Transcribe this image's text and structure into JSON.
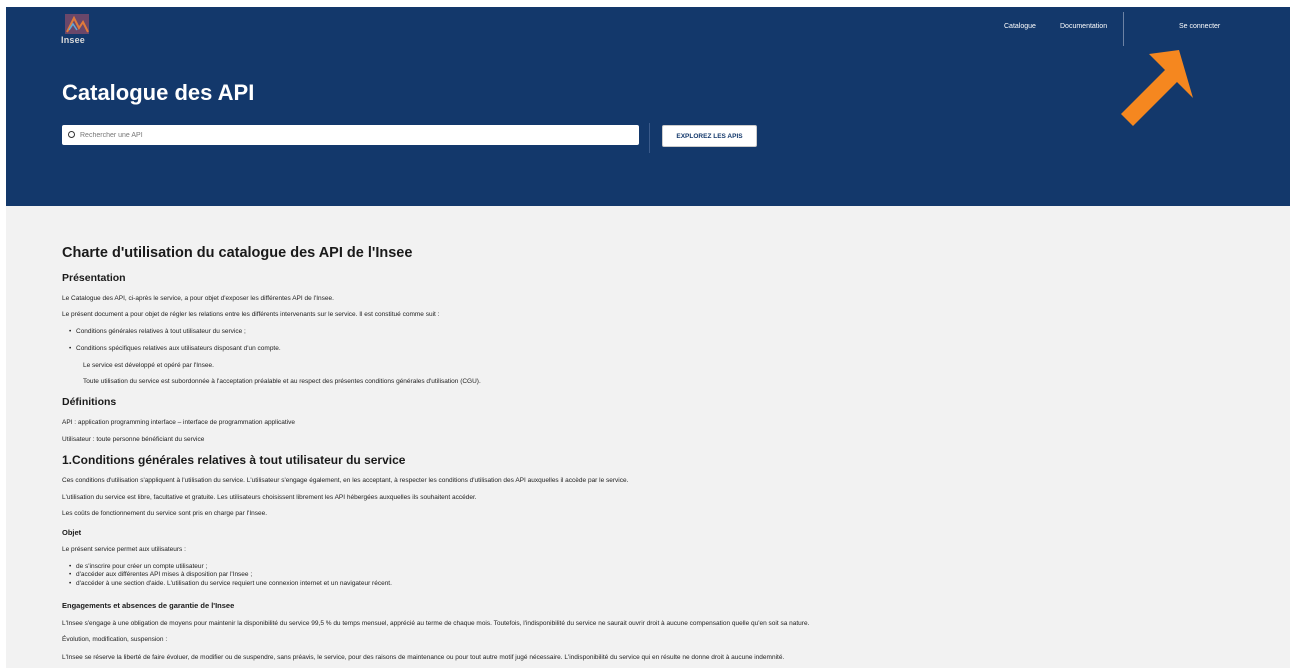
{
  "header": {
    "logo_text": "Insee",
    "nav": {
      "catalogue": "Catalogue",
      "documentation": "Documentation",
      "login": "Se connecter"
    }
  },
  "hero": {
    "title": "Catalogue des API",
    "search_placeholder": "Rechercher une API",
    "explore_button": "EXPLOREZ LES APIS"
  },
  "content": {
    "title": "Charte d'utilisation du catalogue des API de l'Insee",
    "presentation": {
      "heading": "Présentation",
      "p1": "Le Catalogue des API, ci-après le service, a pour objet d'exposer les différentes API de l'Insee.",
      "p2": "Le présent document a pour objet de régler les relations entre les différents intervenants sur le service. Il est constitué comme suit :",
      "bullets": [
        "Conditions générales relatives à tout utilisateur du service ;",
        "Conditions spécifiques relatives aux utilisateurs disposant d'un compte."
      ],
      "indent1": "Le service est développé et opéré par l'Insee.",
      "indent2": "Toute utilisation du service est subordonnée à l'acceptation préalable et au respect des présentes conditions générales d'utilisation (CGU)."
    },
    "definitions": {
      "heading": "Définitions",
      "api": "API : application programming interface – interface de programmation applicative",
      "user": "Utilisateur : toute personne bénéficiant du service"
    },
    "section1": {
      "heading": "1.Conditions générales relatives à tout utilisateur du service",
      "p1": "Ces conditions d'utilisation s'appliquent à l'utilisation du service. L'utilisateur s'engage également, en les acceptant, à respecter les conditions d'utilisation des API auxquelles il accède par le service.",
      "p2": "L'utilisation du service est libre, facultative et gratuite. Les utilisateurs choisissent librement les API hébergées auxquelles ils souhaitent accéder.",
      "p3": "Les coûts de fonctionnement du service sont pris en charge par l'Insee."
    },
    "objet": {
      "heading": "Objet",
      "intro": "Le présent service permet aux utilisateurs :",
      "bullets": [
        "de s'inscrire pour créer un compte utilisateur ;",
        "d'accéder aux différentes API mises à disposition par l'Insee ;",
        "d'accéder à une section d'aide. L'utilisation du service requiert une connexion internet et un navigateur récent."
      ]
    },
    "engagements": {
      "heading": "Engagements et absences de garantie de l'Insee",
      "p1": "L'Insee s'engage à une obligation de moyens pour maintenir la disponibilité du service 99,5 % du temps mensuel, apprécié au terme de chaque mois. Toutefois, l'indisponibilité du service ne saurait ouvrir droit à aucune compensation quelle qu'en soit sa nature.",
      "p2": "Évolution, modification, suspension :",
      "p3": "L'Insee se réserve la liberté de faire évoluer, de modifier ou de suspendre, sans préavis, le service, pour des raisons de maintenance ou pour tout autre motif jugé nécessaire. L'indisponibilité du service qui en résulte ne donne droit à aucune indemnité."
    }
  },
  "colors": {
    "hero_bg": "#13386b",
    "content_bg": "#f2f2f2",
    "arrow": "#f5871f"
  }
}
